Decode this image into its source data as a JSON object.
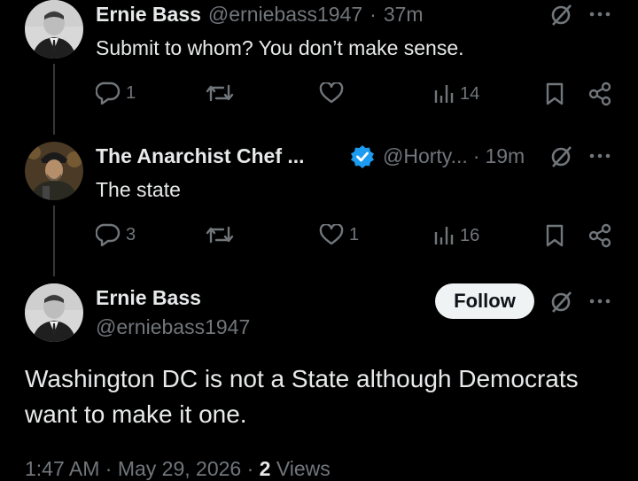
{
  "tweets": [
    {
      "name": "Ernie Bass",
      "handle": "@erniebass1947",
      "time": "37m",
      "text": "Submit to whom? You don’t make sense.",
      "replies": "1",
      "retweets": "",
      "likes": "",
      "views": "14"
    },
    {
      "name": "The Anarchist Chef ...",
      "handle": "@Horty...",
      "time": "19m",
      "text": "The state",
      "replies": "3",
      "retweets": "",
      "likes": "1",
      "views": "16"
    }
  ],
  "main_tweet": {
    "name": "Ernie Bass",
    "handle": "@erniebass1947",
    "follow_label": "Follow",
    "text": "Washington DC is not a State although Democrats want to make it one.",
    "time": "1:47 AM",
    "date": "May 29, 2026",
    "views_count": "2",
    "views_label": "Views"
  },
  "separator": "·",
  "colors": {
    "background": "#000000",
    "text": "#e7e9ea",
    "muted": "#71767b",
    "verified": "#1d9bf0"
  }
}
